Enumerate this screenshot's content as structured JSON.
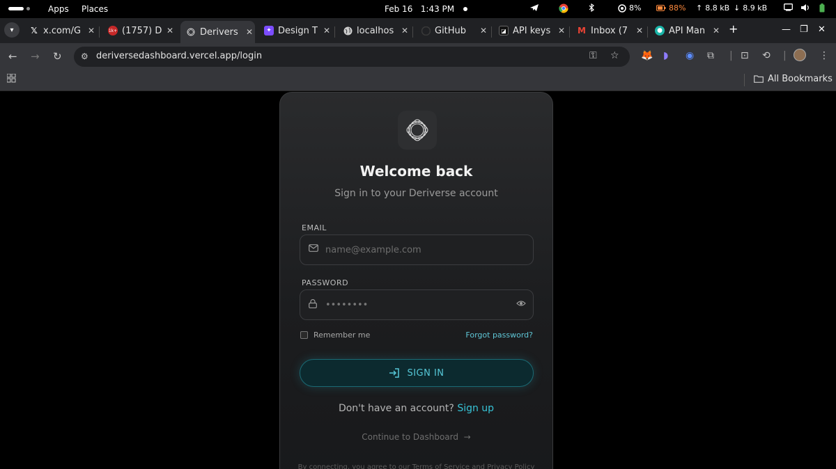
{
  "system_bar": {
    "apps": "Apps",
    "places": "Places",
    "date": "Feb 16",
    "time": "1:43 PM",
    "cpu": "8%",
    "battery": "88%",
    "upload": "8.8 kB",
    "download": "8.9 kB"
  },
  "tabs": [
    {
      "title": "x.com/G",
      "icon": "x-logo-icon",
      "color": "#000000"
    },
    {
      "title": "(1757) D",
      "icon": "badge-icon",
      "color": "#c62828",
      "badge": "1k+"
    },
    {
      "title": "Derivers",
      "icon": "deriverse-icon",
      "color": "#5f6368",
      "active": true
    },
    {
      "title": "Design T",
      "icon": "design-icon",
      "color": "#7c4dff"
    },
    {
      "title": "localhos",
      "icon": "globe-icon",
      "color": "#5f6368"
    },
    {
      "title": "GitHub",
      "icon": "github-icon",
      "color": "#3a3a3a"
    },
    {
      "title": "API keys",
      "icon": "api-icon",
      "color": "#111111"
    },
    {
      "title": "Inbox (7",
      "icon": "gmail-icon",
      "color": "#ea4335"
    },
    {
      "title": "API Man",
      "icon": "api-manager-icon",
      "color": "#1bb5a8"
    }
  ],
  "address_bar": {
    "url": "deriversedashboard.vercel.app/login"
  },
  "bookmarks": {
    "all_bookmarks": "All Bookmarks"
  },
  "login": {
    "title": "Welcome back",
    "subtitle": "Sign in to your Deriverse account",
    "email_label": "EMAIL",
    "email_placeholder": "name@example.com",
    "password_label": "PASSWORD",
    "password_value": "••••••••",
    "remember_me": "Remember me",
    "forgot_password": "Forgot password?",
    "sign_in": "SIGN IN",
    "no_account": "Don't have an account?",
    "sign_up": "Sign up",
    "continue": "Continue to Dashboard",
    "terms": "By connecting, you agree to our Terms of Service and Privacy Policy"
  },
  "colors": {
    "accent": "#37c3d6",
    "signin_bg": "#0c2a2f",
    "card_bg": "#1c1d1f",
    "battery": "#ff8a3d",
    "battery_fill_fraction": 0.88
  }
}
